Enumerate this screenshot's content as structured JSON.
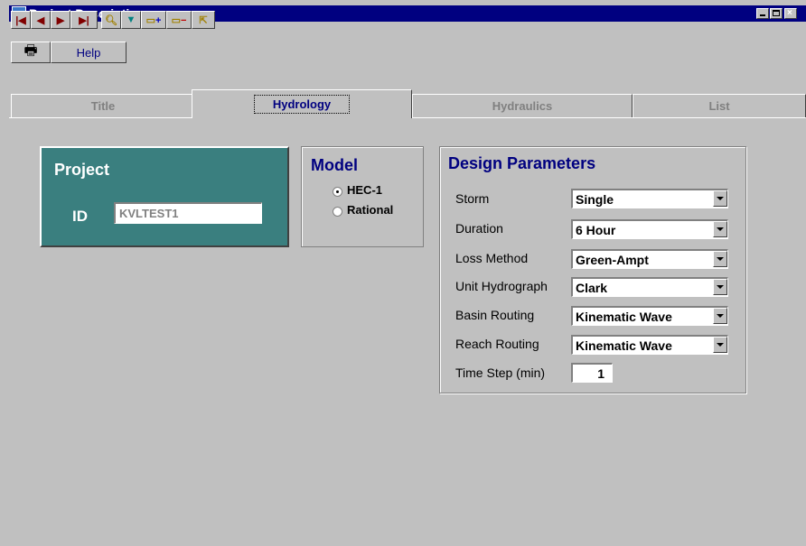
{
  "window": {
    "title": "Project Descriptions"
  },
  "toolbar": {
    "nav_buttons": [
      "first-record",
      "previous-record",
      "next-record",
      "last-record",
      "find-record",
      "filter-records",
      "add-record",
      "delete-record",
      "exit"
    ],
    "print_icon": "printer-icon",
    "help_label": "Help"
  },
  "tabs": [
    {
      "label": "Title",
      "active": false
    },
    {
      "label": "Hydrology",
      "active": true
    },
    {
      "label": "Hydraulics",
      "active": false
    },
    {
      "label": "List",
      "active": false
    }
  ],
  "project": {
    "heading": "Project",
    "id_label": "ID",
    "id_value": "KVLTEST1"
  },
  "model": {
    "heading": "Model",
    "options": [
      "HEC-1",
      "Rational"
    ],
    "selected": "HEC-1"
  },
  "design": {
    "heading": "Design Parameters",
    "storm": {
      "label": "Storm",
      "value": "Single"
    },
    "duration": {
      "label": "Duration",
      "value": "6 Hour"
    },
    "loss": {
      "label": "Loss Method",
      "value": "Green-Ampt"
    },
    "unit": {
      "label": "Unit Hydrograph",
      "value": "Clark"
    },
    "basin": {
      "label": "Basin Routing",
      "value": "Kinematic Wave"
    },
    "reach": {
      "label": "Reach Routing",
      "value": "Kinematic Wave"
    },
    "timestep": {
      "label": "Time Step (min)",
      "value": "1"
    }
  },
  "colors": {
    "titlebar": "#000080",
    "project_panel": "#3a7f7f",
    "heading_blue": "#000080",
    "window_bg": "#c0c0c0"
  }
}
